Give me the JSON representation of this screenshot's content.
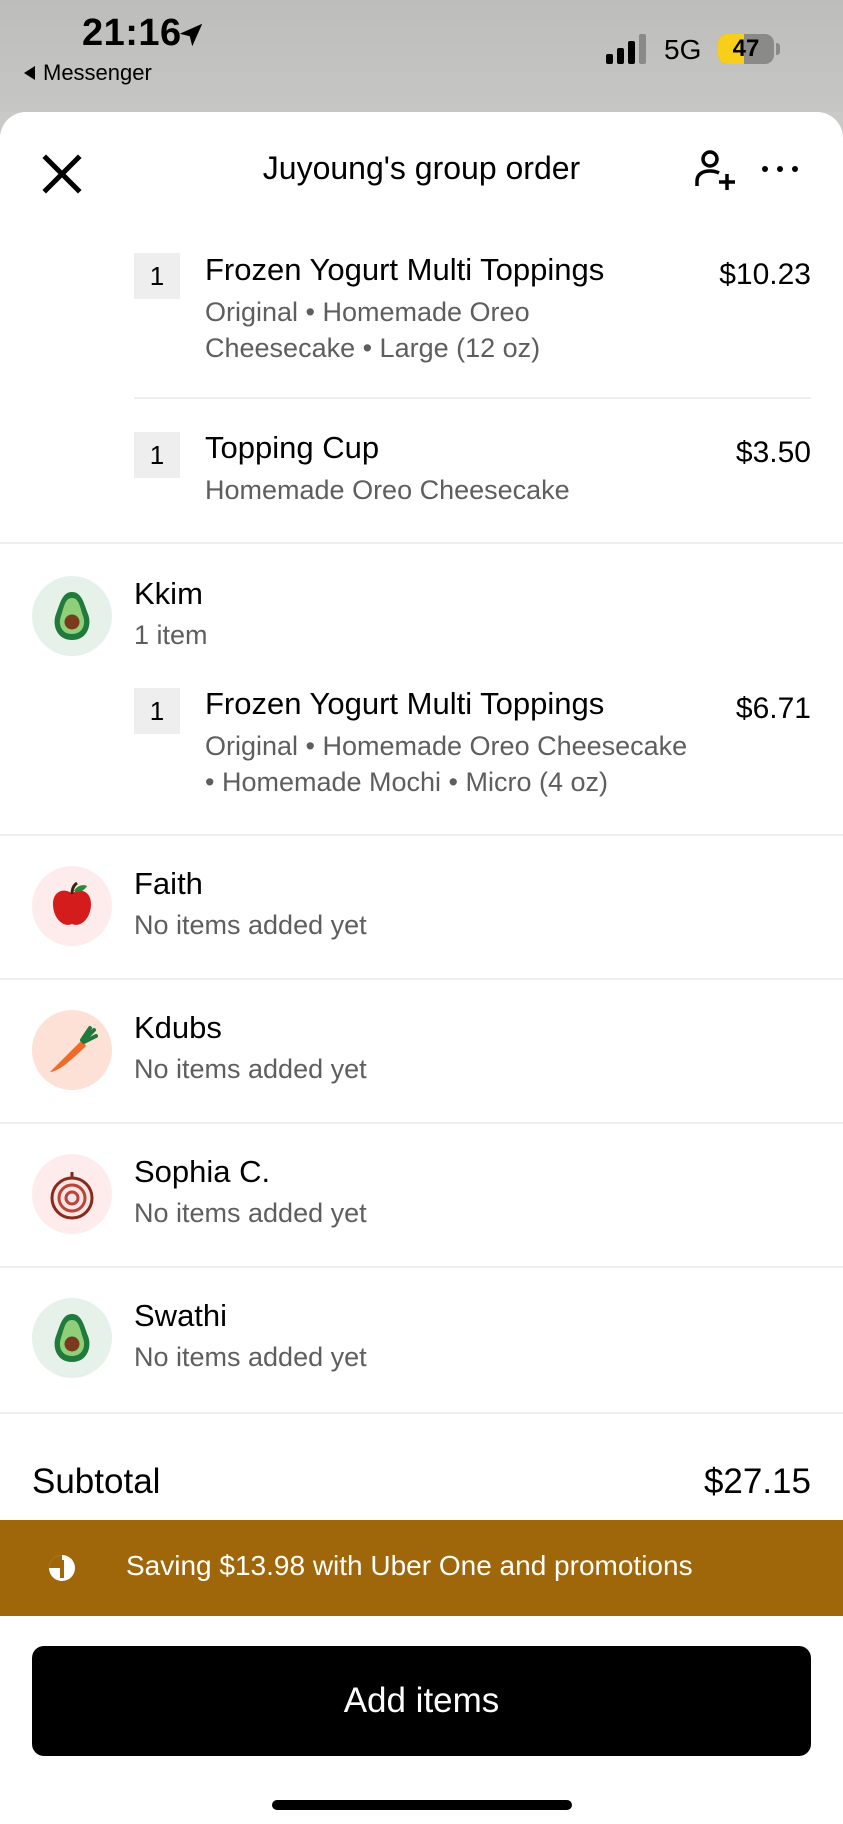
{
  "status_bar": {
    "time": "21:16",
    "back_app": "Messenger",
    "network": "5G",
    "battery": "47",
    "battery_level": 0.47
  },
  "header": {
    "title": "Juyoung's group order"
  },
  "host_items": [
    {
      "qty": "1",
      "name": "Frozen Yogurt Multi Toppings",
      "desc_line1": "Original • Homemade Oreo",
      "desc_line2": "Cheesecake • Large (12 oz)",
      "price": "$10.23"
    },
    {
      "qty": "1",
      "name": "Topping Cup",
      "desc_line1": "Homemade Oreo Cheesecake",
      "price": "$3.50"
    }
  ],
  "members": [
    {
      "name": "Kkim",
      "subtitle": "1 item",
      "avatar": "avocado-icon",
      "items": [
        {
          "qty": "1",
          "name": "Frozen Yogurt Multi Toppings",
          "desc_line1": "Original • Homemade Oreo Cheesecake",
          "desc_line2": "• Homemade Mochi • Micro (4 oz)",
          "price": "$6.71"
        }
      ]
    },
    {
      "name": "Faith",
      "subtitle": "No items added yet",
      "avatar": "apple-icon"
    },
    {
      "name": "Kdubs",
      "subtitle": "No items added yet",
      "avatar": "carrot-icon"
    },
    {
      "name": "Sophia C.",
      "subtitle": "No items added yet",
      "avatar": "onion-icon"
    },
    {
      "name": "Swathi",
      "subtitle": "No items added yet",
      "avatar": "avocado-icon"
    }
  ],
  "subtotal": {
    "label": "Subtotal",
    "value": "$27.15"
  },
  "promo": {
    "text": "Saving $13.98 with Uber One and promotions",
    "color": "#a0660a"
  },
  "cta": {
    "label": "Add items"
  }
}
